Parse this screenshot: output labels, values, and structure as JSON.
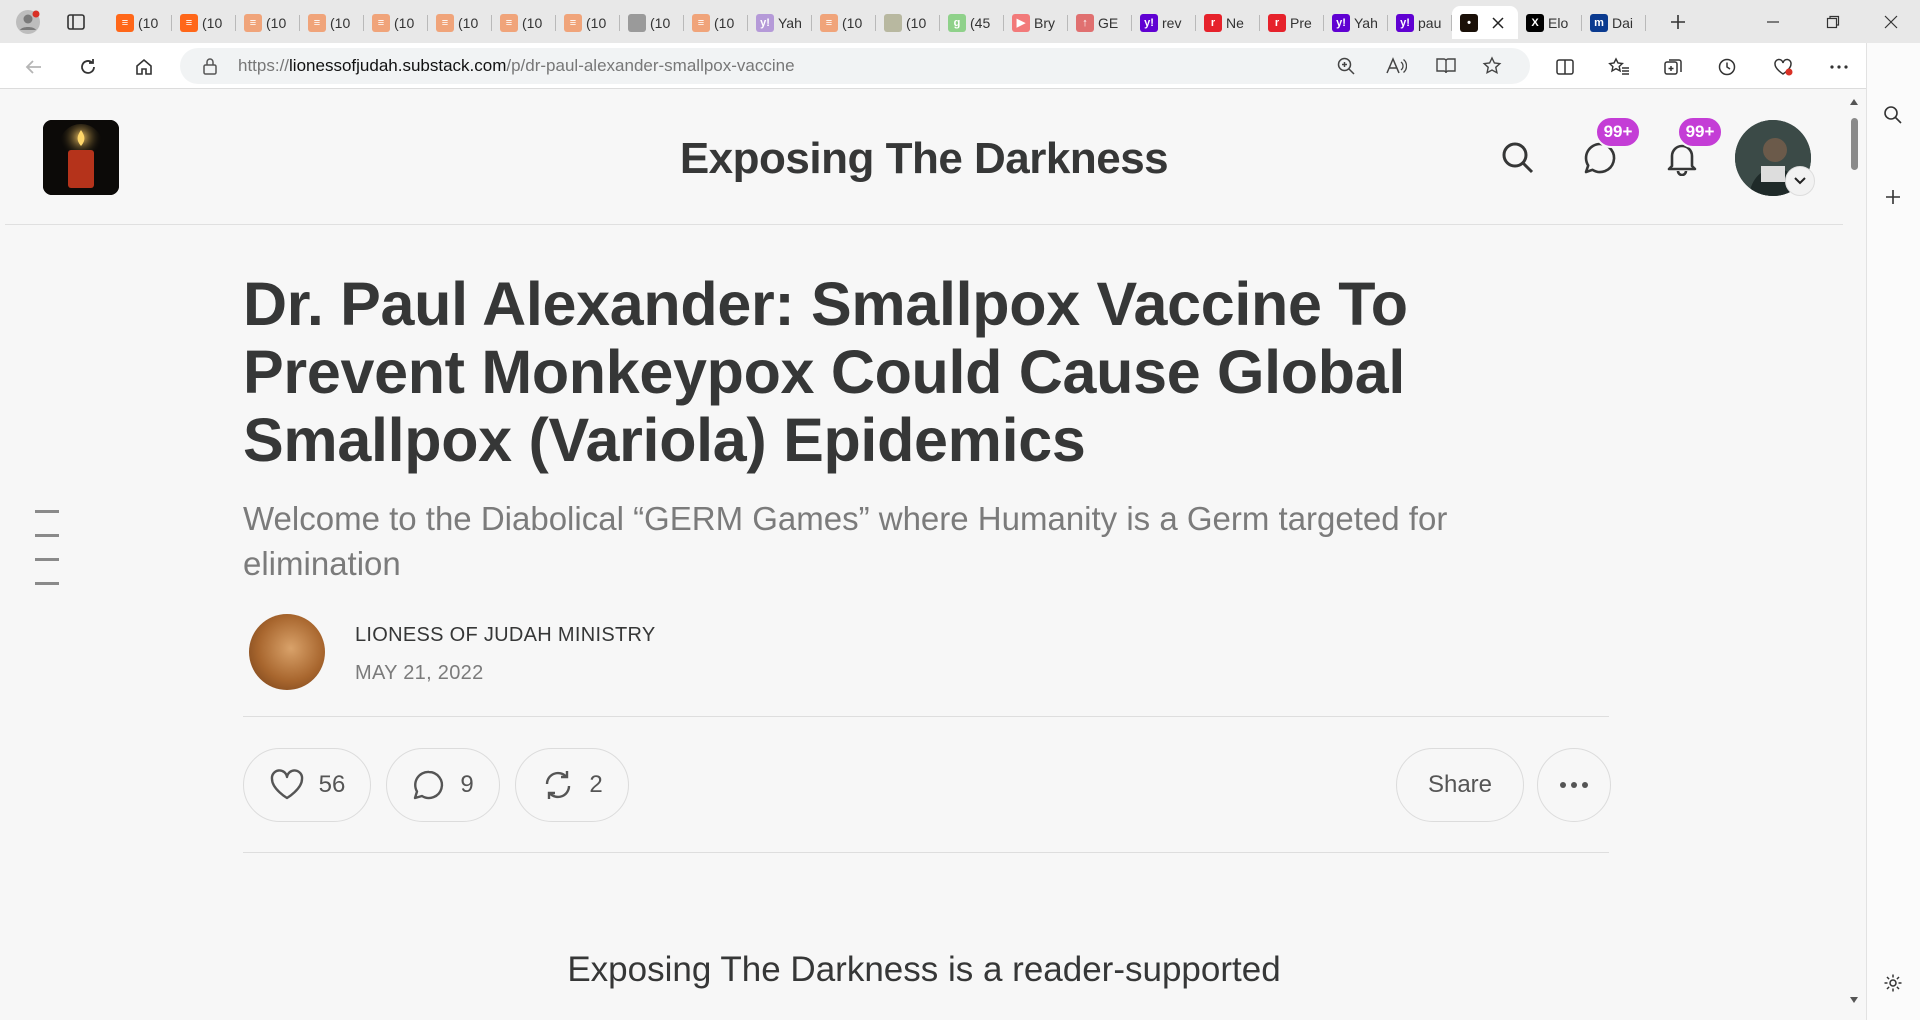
{
  "browser": {
    "tabs": [
      {
        "label": "(10",
        "fav": "substack",
        "color": "#ff6719"
      },
      {
        "label": "(10",
        "fav": "substack",
        "color": "#ff6719"
      },
      {
        "label": "(10",
        "fav": "substack",
        "color": "#f0a47a"
      },
      {
        "label": "(10",
        "fav": "substack",
        "color": "#f0a47a"
      },
      {
        "label": "(10",
        "fav": "substack",
        "color": "#f0a47a"
      },
      {
        "label": "(10",
        "fav": "substack",
        "color": "#f0a47a"
      },
      {
        "label": "(10",
        "fav": "substack",
        "color": "#f0a47a"
      },
      {
        "label": "(10",
        "fav": "substack",
        "color": "#f0a47a"
      },
      {
        "label": "(10",
        "fav": "photo",
        "color": "#9a9a9a"
      },
      {
        "label": "(10",
        "fav": "substack",
        "color": "#f0a47a"
      },
      {
        "label": "Yah",
        "fav": "yahoo",
        "color": "#b59ad8"
      },
      {
        "label": "(10",
        "fav": "substack",
        "color": "#f0a47a"
      },
      {
        "label": "(10",
        "fav": "photo",
        "color": "#b8b8a0"
      },
      {
        "label": "(45",
        "fav": "g",
        "color": "#8fd18a"
      },
      {
        "label": "Bry",
        "fav": "youtube",
        "color": "#f27a7a"
      },
      {
        "label": "GE",
        "fav": "gettr",
        "color": "#e07070"
      },
      {
        "label": "rev",
        "fav": "yahoo",
        "color": "#6001d2"
      },
      {
        "label": "Ne",
        "fav": "r",
        "color": "#e6222b"
      },
      {
        "label": "Pre",
        "fav": "r",
        "color": "#e6222b"
      },
      {
        "label": "Yah",
        "fav": "yahoo",
        "color": "#6001d2"
      },
      {
        "label": "pau",
        "fav": "yahoo",
        "color": "#6001d2"
      },
      {
        "label": "",
        "fav": "candle",
        "color": "#1a1008",
        "active": true
      },
      {
        "label": "Elo",
        "fav": "x",
        "color": "#000000"
      },
      {
        "label": "Dai",
        "fav": "m",
        "color": "#0a3a8f"
      }
    ],
    "url": {
      "scheme": "https://",
      "host": "lionessofjudah.substack.com",
      "path": "/p/dr-paul-alexander-smallpox-vaccine"
    }
  },
  "publication": {
    "name": "Exposing The Darkness",
    "chat_badge": "99+",
    "notifications_badge": "99+"
  },
  "post": {
    "title": "Dr. Paul Alexander: Smallpox Vaccine To Prevent Monkeypox Could Cause Global Smallpox (Variola) Epidemics",
    "subtitle": "Welcome to the Diabolical “GERM Games” where Humanity is a Germ targeted for elimination",
    "author": "LIONESS OF JUDAH MINISTRY",
    "date": "MAY 21, 2022",
    "likes": "56",
    "comments": "9",
    "restacks": "2",
    "share_label": "Share",
    "cta_text": "Exposing The Darkness is a reader-supported"
  },
  "colors": {
    "badge": "#c43dd6",
    "text": "#363737",
    "muted": "#7b7b7b"
  }
}
